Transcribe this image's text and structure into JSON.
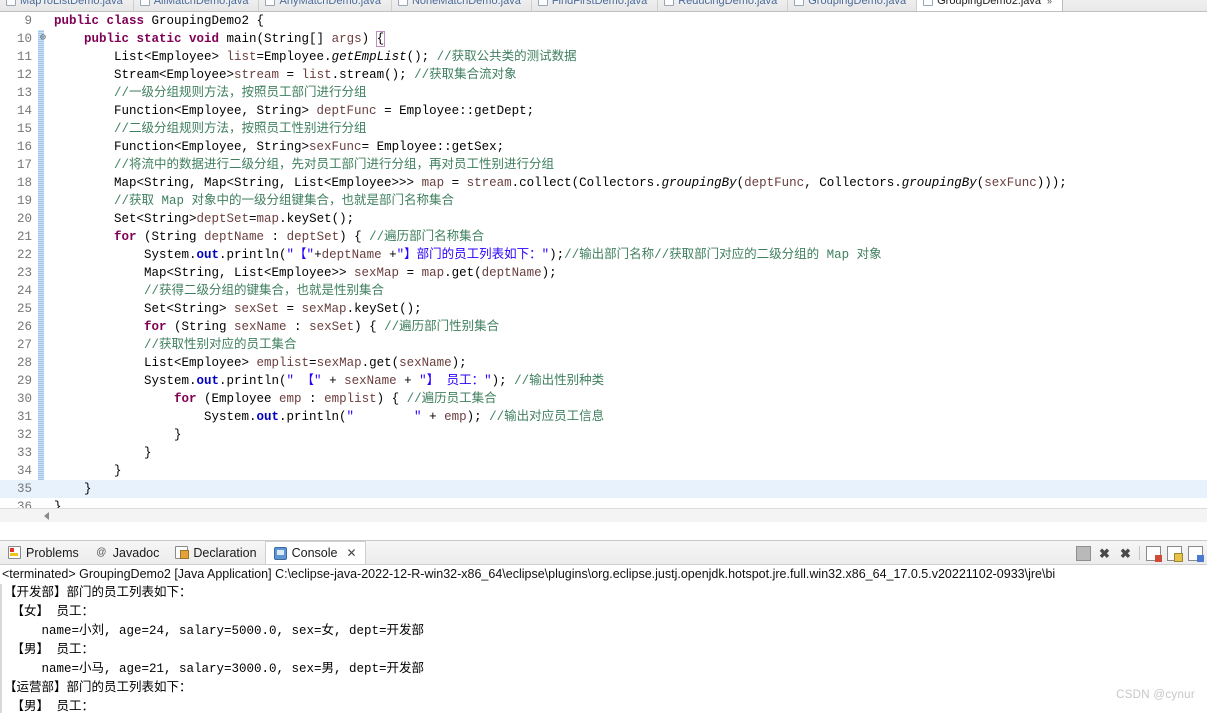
{
  "editor_tabs": [
    {
      "label": "MapToListDemo.java",
      "active": false
    },
    {
      "label": "AllMatchDemo.java",
      "active": false
    },
    {
      "label": "AnyMatchDemo.java",
      "active": false
    },
    {
      "label": "NoneMatchDemo.java",
      "active": false
    },
    {
      "label": "FindFirstDemo.java",
      "active": false
    },
    {
      "label": "ReducingDemo.java",
      "active": false
    },
    {
      "label": "GroupingDemo.java",
      "active": false
    },
    {
      "label": "GroupingDemo2.java",
      "active": true
    }
  ],
  "editor": {
    "first_line": 9,
    "current_line": 35,
    "fold_marker_line": 10,
    "lines": [
      {
        "n": 9,
        "html": "<span class=\"kw\">public class</span> <span class=\"pl\">GroupingDemo2 {</span>",
        "indent": 0
      },
      {
        "n": 10,
        "html": "<span class=\"kw\">public static void</span> <span class=\"pl\">main(String[] </span><span class=\"loc\">args</span><span class=\"pl\">) </span><span class=\"brkt\">{</span>",
        "indent": 1,
        "fold": true
      },
      {
        "n": 11,
        "html": "<span class=\"pl\">List&lt;Employee&gt; </span><span class=\"loc\">list</span><span class=\"pl\">=Employee.</span><span class=\"ital\">getEmpList</span><span class=\"pl\">(); </span><span class=\"cmt\">//获取公共类的测试数据</span>",
        "indent": 2
      },
      {
        "n": 12,
        "html": "<span class=\"pl\">Stream&lt;Employee&gt;</span><span class=\"loc\">stream</span><span class=\"pl\"> = </span><span class=\"loc\">list</span><span class=\"pl\">.stream(); </span><span class=\"cmt\">//获取集合流对象</span>",
        "indent": 2
      },
      {
        "n": 13,
        "html": "<span class=\"cmt\">//一级分组规则方法，按照员工部门进行分组</span>",
        "indent": 2
      },
      {
        "n": 14,
        "html": "<span class=\"pl\">Function&lt;Employee, String&gt; </span><span class=\"loc\">deptFunc</span><span class=\"pl\"> = Employee::getDept;</span>",
        "indent": 2
      },
      {
        "n": 15,
        "html": "<span class=\"cmt\">//二级分组规则方法，按照员工性别进行分组</span>",
        "indent": 2
      },
      {
        "n": 16,
        "html": "<span class=\"pl\">Function&lt;Employee, String&gt;</span><span class=\"loc\">sexFunc</span><span class=\"pl\">= Employee::getSex;</span>",
        "indent": 2
      },
      {
        "n": 17,
        "html": "<span class=\"cmt\">//将流中的数据进行二级分组，先对员工部门进行分组，再对员工性别进行分组</span>",
        "indent": 2
      },
      {
        "n": 18,
        "html": "<span class=\"pl\">Map&lt;String, Map&lt;String, List&lt;Employee&gt;&gt;&gt; </span><span class=\"loc\">map</span><span class=\"pl\"> = </span><span class=\"loc\">stream</span><span class=\"pl\">.collect(Collectors.</span><span class=\"ital\">groupingBy</span><span class=\"pl\">(</span><span class=\"loc\">deptFunc</span><span class=\"pl\">, Collectors.</span><span class=\"ital\">groupingBy</span><span class=\"pl\">(</span><span class=\"loc\">sexFunc</span><span class=\"pl\">)));</span>",
        "indent": 2
      },
      {
        "n": 19,
        "html": "<span class=\"cmt\">//获取 Map 对象中的一级分组键集合，也就是部门名称集合</span>",
        "indent": 2
      },
      {
        "n": 20,
        "html": "<span class=\"pl\">Set&lt;String&gt;</span><span class=\"loc\">deptSet</span><span class=\"pl\">=</span><span class=\"loc\">map</span><span class=\"pl\">.keySet();</span>",
        "indent": 2
      },
      {
        "n": 21,
        "html": "<span class=\"kw\">for</span><span class=\"pl\"> (String </span><span class=\"loc\">deptName</span><span class=\"pl\"> : </span><span class=\"loc\">deptSet</span><span class=\"pl\">) { </span><span class=\"cmt\">//遍历部门名称集合</span>",
        "indent": 2
      },
      {
        "n": 22,
        "html": "<span class=\"pl\">System.</span><span class=\"stat\">out</span><span class=\"pl\">.println(</span><span class=\"str\">\"【\"</span><span class=\"pl\">+</span><span class=\"loc\">deptName</span><span class=\"pl\"> +</span><span class=\"str\">\"】部门的员工列表如下：\"</span><span class=\"pl\">);</span><span class=\"cmt\">//输出部门名称//获取部门对应的二级分组的 Map 对象</span>",
        "indent": 3
      },
      {
        "n": 23,
        "html": "<span class=\"pl\">Map&lt;String, List&lt;Employee&gt;&gt; </span><span class=\"loc\">sexMap</span><span class=\"pl\"> = </span><span class=\"loc\">map</span><span class=\"pl\">.get(</span><span class=\"loc\">deptName</span><span class=\"pl\">);</span>",
        "indent": 3
      },
      {
        "n": 24,
        "html": "<span class=\"cmt\">//获得二级分组的键集合，也就是性别集合</span>",
        "indent": 3
      },
      {
        "n": 25,
        "html": "<span class=\"pl\">Set&lt;String&gt; </span><span class=\"loc\">sexSet</span><span class=\"pl\"> = </span><span class=\"loc\">sexMap</span><span class=\"pl\">.keySet();</span>",
        "indent": 3
      },
      {
        "n": 26,
        "html": "<span class=\"kw\">for</span><span class=\"pl\"> (String </span><span class=\"loc\">sexName</span><span class=\"pl\"> : </span><span class=\"loc\">sexSet</span><span class=\"pl\">) { </span><span class=\"cmt\">//遍历部门性别集合</span>",
        "indent": 3
      },
      {
        "n": 27,
        "html": "<span class=\"cmt\">//获取性别对应的员工集合</span>",
        "indent": 3
      },
      {
        "n": 28,
        "html": "<span class=\"pl\">List&lt;Employee&gt; </span><span class=\"loc\">emplist</span><span class=\"pl\">=</span><span class=\"loc\">sexMap</span><span class=\"pl\">.get(</span><span class=\"loc\">sexName</span><span class=\"pl\">);</span>",
        "indent": 3
      },
      {
        "n": 29,
        "html": "<span class=\"pl\">System.</span><span class=\"stat\">out</span><span class=\"pl\">.println(</span><span class=\"str\">\" 【\"</span><span class=\"pl\"> + </span><span class=\"loc\">sexName</span><span class=\"pl\"> + </span><span class=\"str\">\"】 员工：\"</span><span class=\"pl\">); </span><span class=\"cmt\">//输出性别种类</span>",
        "indent": 3
      },
      {
        "n": 30,
        "html": "<span class=\"kw\">for</span><span class=\"pl\"> (Employee </span><span class=\"loc\">emp</span><span class=\"pl\"> : </span><span class=\"loc\">emplist</span><span class=\"pl\">) { </span><span class=\"cmt\">//遍历员工集合</span>",
        "indent": 4
      },
      {
        "n": 31,
        "html": "<span class=\"pl\">System.</span><span class=\"stat\">out</span><span class=\"pl\">.println(</span><span class=\"str\">\"        \"</span><span class=\"pl\"> + </span><span class=\"loc\">emp</span><span class=\"pl\">); </span><span class=\"cmt\">//输出对应员工信息</span>",
        "indent": 5
      },
      {
        "n": 32,
        "html": "<span class=\"pl\">}</span>",
        "indent": 4
      },
      {
        "n": 33,
        "html": "<span class=\"pl\">}</span>",
        "indent": 3
      },
      {
        "n": 34,
        "html": "<span class=\"pl\">}</span>",
        "indent": 2
      },
      {
        "n": 35,
        "html": "<span class=\"pl\">}</span>",
        "indent": 1
      },
      {
        "n": 36,
        "html": "<span class=\"pl\">}</span>",
        "indent": 0
      }
    ]
  },
  "panel": {
    "tabs": [
      {
        "label": "Problems",
        "icon": "problems-icon",
        "active": false
      },
      {
        "label": "Javadoc",
        "icon": "javadoc-icon",
        "active": false
      },
      {
        "label": "Declaration",
        "icon": "declaration-icon",
        "active": false
      },
      {
        "label": "Console",
        "icon": "console-icon",
        "active": true,
        "closable": true
      }
    ],
    "close_glyph": "✕",
    "toolbar": [
      {
        "name": "terminate-button",
        "glyph": ""
      },
      {
        "name": "remove-launch-button",
        "glyph": "✖"
      },
      {
        "name": "remove-all-terminated-button",
        "glyph": "✖"
      },
      {
        "name": "clear-console-button",
        "glyph": ""
      },
      {
        "name": "scroll-lock-button",
        "glyph": ""
      },
      {
        "name": "pin-console-button",
        "glyph": ""
      }
    ],
    "run_header": "<terminated> GroupingDemo2 [Java Application] C:\\eclipse-java-2022-12-R-win32-x86_64\\eclipse\\plugins\\org.eclipse.justj.openjdk.hotspot.jre.full.win32.x86_64_17.0.5.v20221102-0933\\jre\\bi",
    "output": [
      "【开发部】部门的员工列表如下：",
      " 【女】 员工：",
      "     name=小刘, age=24, salary=5000.0, sex=女, dept=开发部",
      " 【男】 员工：",
      "     name=小马, age=21, salary=3000.0, sex=男, dept=开发部",
      "【运营部】部门的员工列表如下：",
      " 【男】 员工："
    ]
  },
  "watermark": "CSDN @cynur",
  "colors": {
    "keyword": "#7f0055",
    "comment": "#3f7f5f",
    "string": "#2a00ff",
    "static_field": "#0000c0",
    "local_var": "#6a3e3e",
    "current_line_highlight": "#e8f2fd",
    "change_bar": "#9fc6ea"
  }
}
